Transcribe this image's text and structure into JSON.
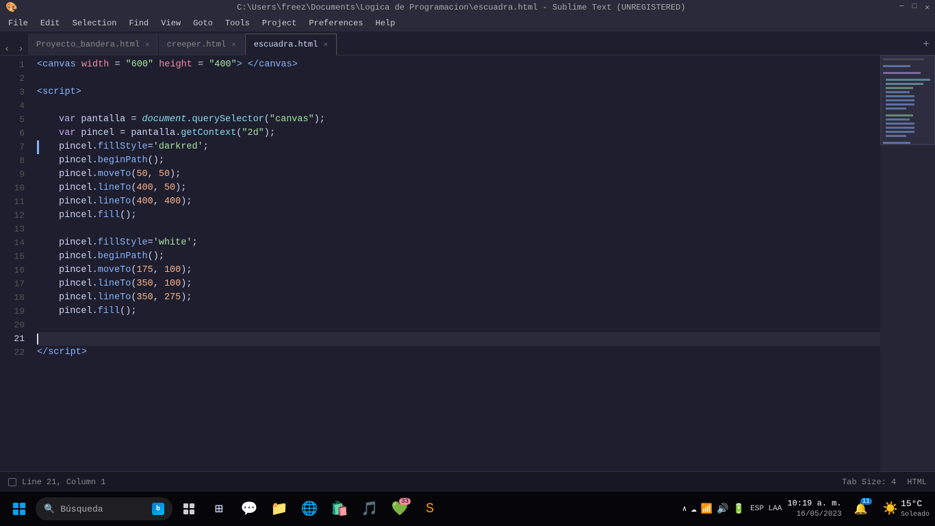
{
  "titlebar": {
    "title": "C:\\Users\\freez\\Documents\\Logica de Programacion\\escuadra.html - Sublime Text (UNREGISTERED)",
    "min": "─",
    "max": "□",
    "close": "✕"
  },
  "menubar": {
    "items": [
      "File",
      "Edit",
      "Selection",
      "Find",
      "View",
      "Goto",
      "Tools",
      "Project",
      "Preferences",
      "Help"
    ]
  },
  "tabs": [
    {
      "label": "Proyecto_bandera.html",
      "active": false,
      "closeable": true
    },
    {
      "label": "creeper.html",
      "active": false,
      "closeable": true
    },
    {
      "label": "escuadra.html",
      "active": true,
      "closeable": true
    }
  ],
  "code": {
    "lines": [
      {
        "num": 1,
        "content": "canvas_line"
      },
      {
        "num": 2,
        "content": ""
      },
      {
        "num": 3,
        "content": "script_open"
      },
      {
        "num": 4,
        "content": ""
      },
      {
        "num": 5,
        "content": "var_pantalla"
      },
      {
        "num": 6,
        "content": "var_pincel"
      },
      {
        "num": 7,
        "content": "fillStyle_darkred"
      },
      {
        "num": 8,
        "content": "beginPath"
      },
      {
        "num": 9,
        "content": "moveTo_50_50"
      },
      {
        "num": 10,
        "content": "lineTo_400_50"
      },
      {
        "num": 11,
        "content": "lineTo_400_400"
      },
      {
        "num": 12,
        "content": "fill"
      },
      {
        "num": 13,
        "content": ""
      },
      {
        "num": 14,
        "content": "fillStyle_white"
      },
      {
        "num": 15,
        "content": "beginPath2"
      },
      {
        "num": 16,
        "content": "moveTo_175_100"
      },
      {
        "num": 17,
        "content": "lineTo_350_100"
      },
      {
        "num": 18,
        "content": "lineTo_350_275"
      },
      {
        "num": 19,
        "content": "fill2"
      },
      {
        "num": 20,
        "content": ""
      },
      {
        "num": 21,
        "content": "cursor_line",
        "active": true
      },
      {
        "num": 22,
        "content": "script_close"
      }
    ]
  },
  "statusbar": {
    "position": "Line 21, Column 1",
    "tab_size": "Tab Size: 4",
    "language": "HTML"
  },
  "taskbar": {
    "search_placeholder": "Búsqueda",
    "weather_temp": "15°C",
    "weather_condition": "Soleado",
    "language": "ESP LAA",
    "time": "10:19 a. m.",
    "date": "16/05/2023",
    "notification_badge": "33"
  }
}
